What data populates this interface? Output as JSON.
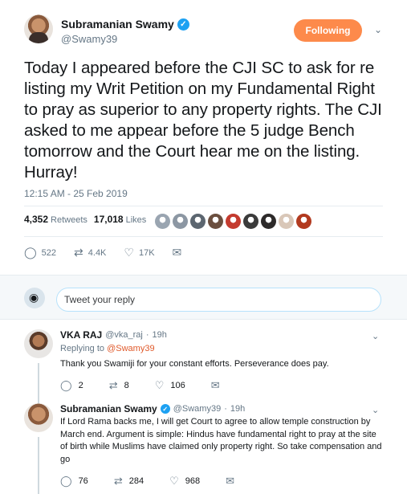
{
  "tweet": {
    "author": {
      "name": "Subramanian Swamy",
      "handle": "@Swamy39"
    },
    "follow_label": "Following",
    "text": "Today I appeared before the CJI SC to ask for re listing my Writ Petition on my Fundamental Right to pray as superior to any property rights. The CJI asked to me appear before the 5 judge Bench tomorrow and the Court hear me on the listing. Hurray!",
    "timestamp": "12:15 AM - 25 Feb 2019",
    "stats": {
      "retweets_count": "4,352",
      "retweets_label": "Retweets",
      "likes_count": "17,018",
      "likes_label": "Likes"
    },
    "liker_colors": [
      "#9aa5b1",
      "#8c97a3",
      "#5c6670",
      "#6b4f3f",
      "#c43b2f",
      "#3b3b3b",
      "#2d2a2a",
      "#d9c7b8",
      "#b23a1f"
    ],
    "actions": {
      "replies": "522",
      "retweets": "4.4K",
      "likes": "17K"
    }
  },
  "reply_box": {
    "placeholder": "Tweet your reply"
  },
  "replies": [
    {
      "name": "VKA RAJ",
      "handle": "@vka_raj",
      "time": "19h",
      "replying_prefix": "Replying to",
      "replying_to": "@Swamy39",
      "text": "Thank you Swamiji for your constant efforts. Perseverance does pay.",
      "actions": {
        "replies": "2",
        "retweets": "8",
        "likes": "106"
      }
    },
    {
      "name": "Subramanian Swamy",
      "handle": "@Swamy39",
      "time": "19h",
      "text": "If Lord Rama backs me, I will get Court to agree to allow temple construction by March end. Argument is simple: Hindus have fundamental right to pray at the site of birth while Muslims have claimed only property right. So take compensation and go",
      "actions": {
        "replies": "76",
        "retweets": "284",
        "likes": "968"
      }
    }
  ],
  "icons": {
    "verified": "verified-badge-icon",
    "chevron": "chevron-down-icon",
    "reply": "reply-icon",
    "retweet": "retweet-icon",
    "like": "heart-icon",
    "dm": "envelope-icon"
  },
  "colors": {
    "accent": "#fd8a4b",
    "link": "#e0592a",
    "verified": "#1da1f2"
  }
}
